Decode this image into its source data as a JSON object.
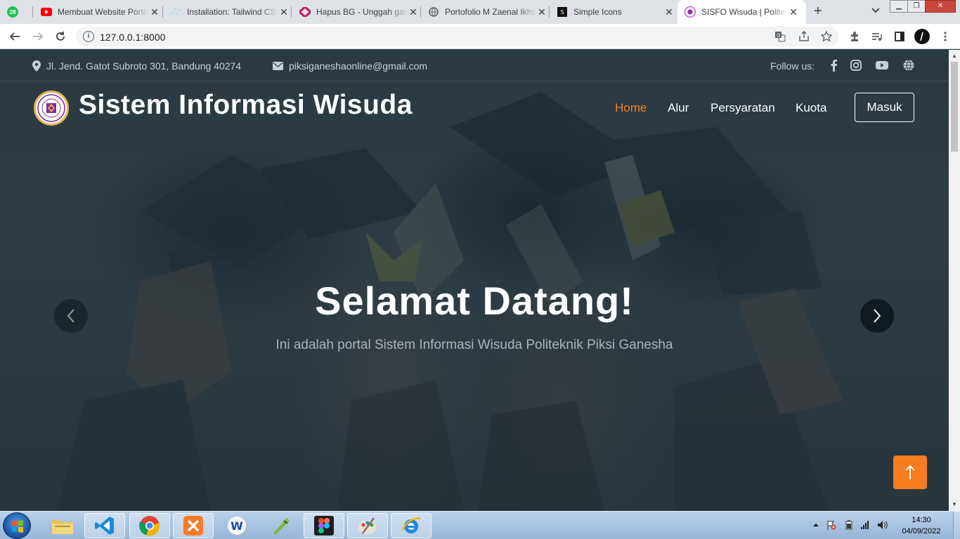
{
  "browser": {
    "tabs": [
      {
        "label": "",
        "badge": "28"
      },
      {
        "label": "Membuat Website Portofolio"
      },
      {
        "label": "Installation: Tailwind CSS"
      },
      {
        "label": "Hapus BG - Unggah gambar"
      },
      {
        "label": "Portofolio M Zaenal Ikhsan"
      },
      {
        "label": "Simple Icons"
      },
      {
        "label": "SISFO Wisuda | Politeknik Piksi Ganesha"
      }
    ],
    "close_glyph": "✕",
    "new_tab": "+",
    "url": "127.0.0.1:8000"
  },
  "site": {
    "address": "Jl. Jend. Gatot Subroto 301, Bandung 40274",
    "email": "piksiganeshaonline@gmail.com",
    "follow_label": "Follow us:",
    "social": [
      "facebook-icon",
      "instagram-icon",
      "youtube-icon",
      "globe-icon"
    ],
    "brand": "Sistem Informasi Wisuda",
    "nav": [
      "Home",
      "Alur",
      "Persyaratan",
      "Kuota"
    ],
    "login": "Masuk",
    "hero_title": "Selamat Datang!",
    "hero_subtitle": "Ini adalah portal Sistem Informasi Wisuda Politeknik Piksi Ganesha",
    "accent_color": "#f57c1f"
  },
  "taskbar": {
    "time": "14:30",
    "date": "04/09/2022",
    "apps": [
      "file-explorer-icon",
      "vscode-icon",
      "chrome-icon",
      "xampp-icon",
      "app-w-icon",
      "inkscape-icon",
      "figma-icon",
      "paint-icon",
      "ie-icon"
    ]
  }
}
